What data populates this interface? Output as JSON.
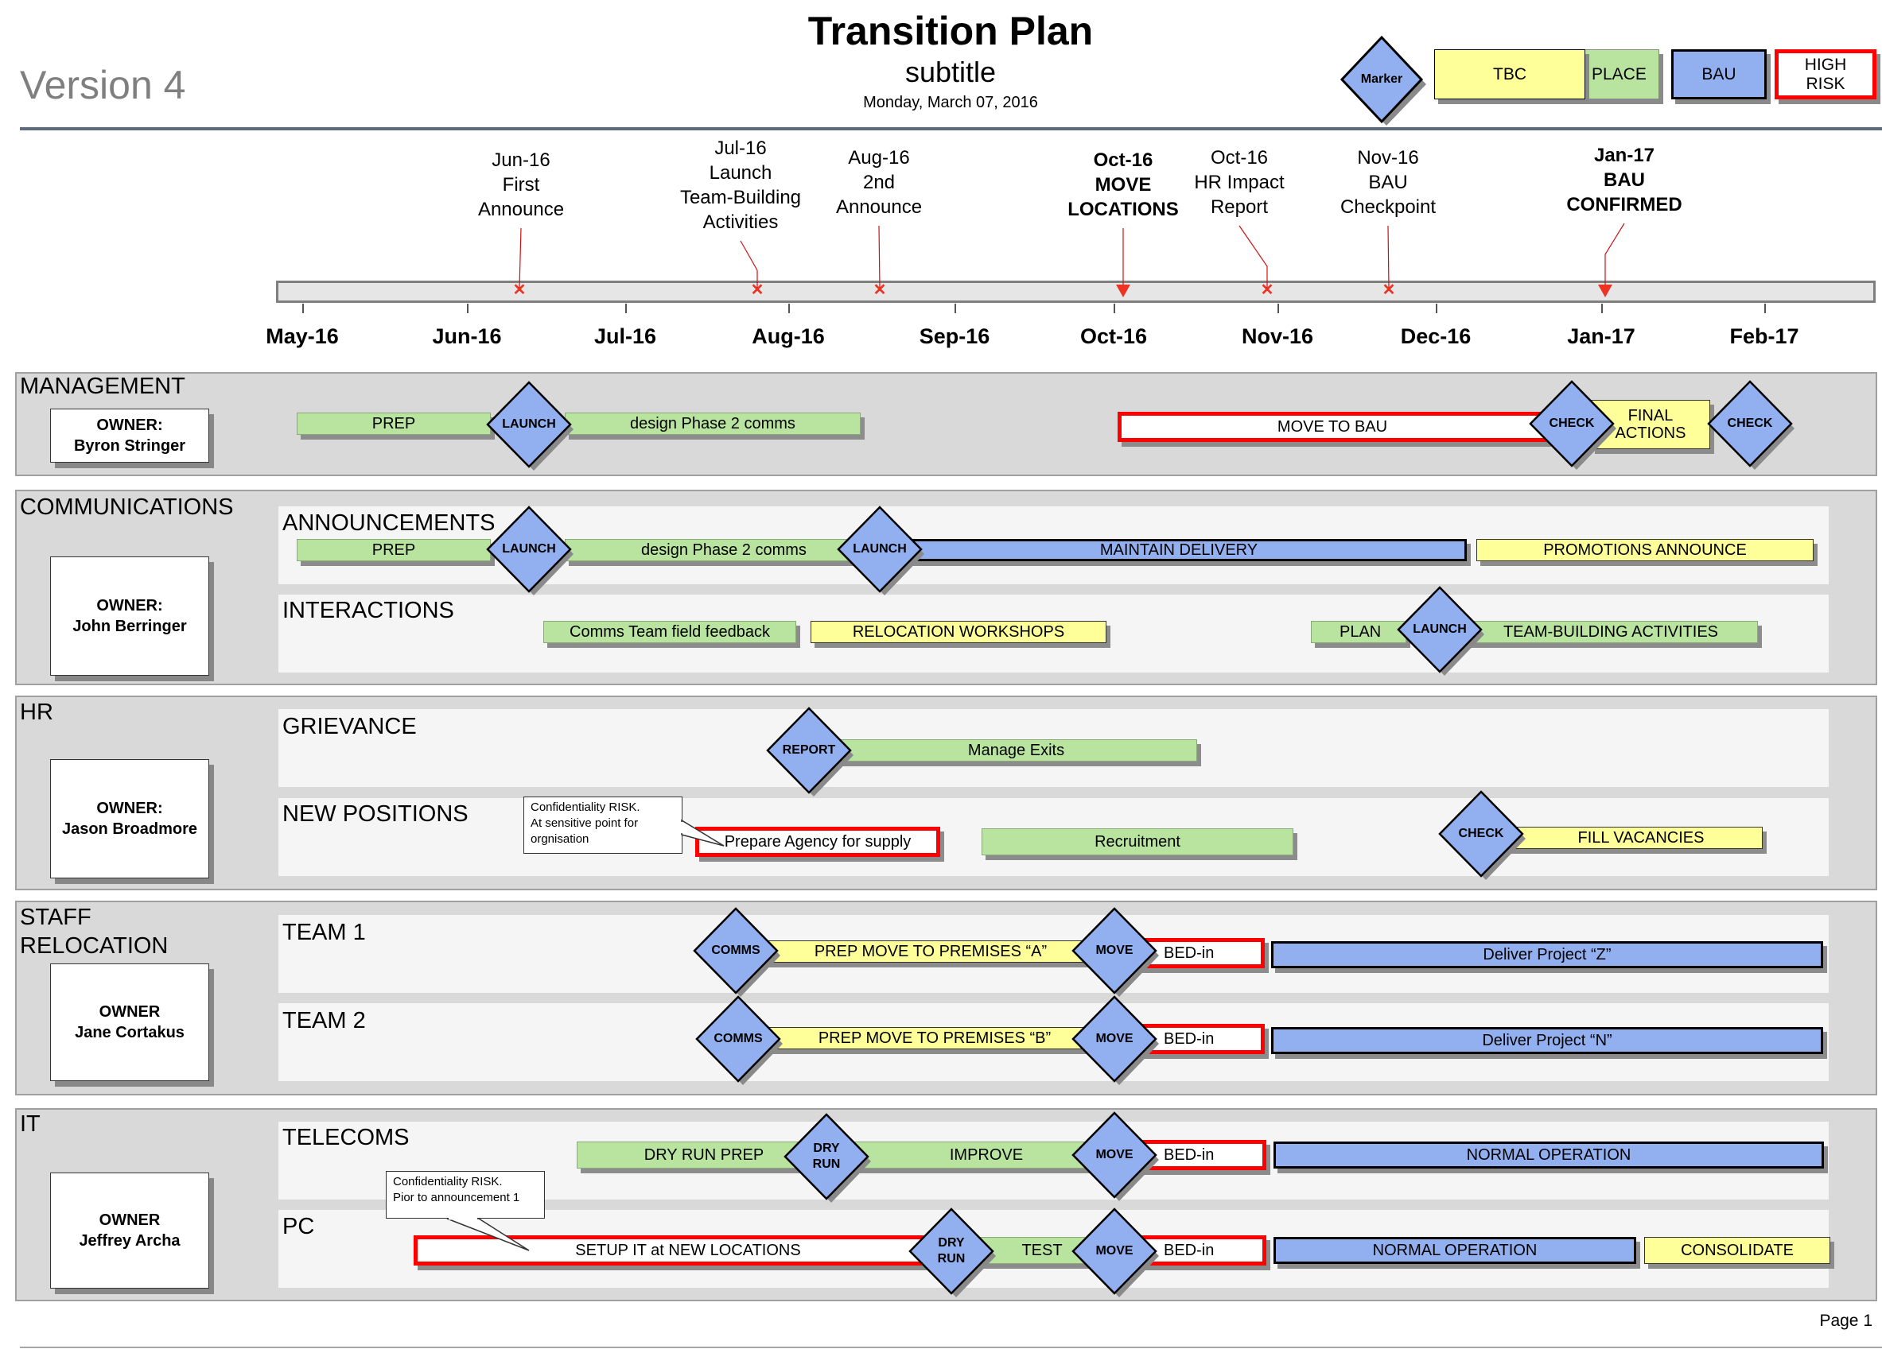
{
  "header": {
    "version": "Version 4",
    "title": "Transition Plan",
    "subtitle": "subtitle",
    "date": "Monday, March 07, 2016",
    "page": "Page 1"
  },
  "legend": {
    "marker": "Marker",
    "tbc": "TBC",
    "in_place": "IN PLACE",
    "bau": "BAU",
    "high_risk_line1": "HIGH",
    "high_risk_line2": "RISK",
    "colors": {
      "tbc": "#ffff99",
      "in_place": "#b8e4a0",
      "bau": "#92afef",
      "high_risk": "#ff0000",
      "marker": "#92afef"
    }
  },
  "timeline": {
    "months": [
      "May-16",
      "Jun-16",
      "Jul-16",
      "Aug-16",
      "Sep-16",
      "Oct-16",
      "Nov-16",
      "Dec-16",
      "Jan-17",
      "Feb-17"
    ],
    "milestones": [
      {
        "lines": [
          "Jun-16",
          "First",
          "Announce"
        ],
        "marker": "x-icon",
        "bold": false
      },
      {
        "lines": [
          "Jul-16",
          "Launch",
          "Team-Building",
          "Activities"
        ],
        "marker": "x-icon",
        "bold": false
      },
      {
        "lines": [
          "Aug-16",
          "2nd",
          "Announce"
        ],
        "marker": "x-icon",
        "bold": false
      },
      {
        "lines": [
          "Oct-16",
          "MOVE",
          "LOCATIONS"
        ],
        "marker": "triangle-down-icon",
        "bold": true
      },
      {
        "lines": [
          "Oct-16",
          "HR Impact",
          "Report"
        ],
        "marker": "x-icon",
        "bold": false
      },
      {
        "lines": [
          "Nov-16",
          "BAU",
          "Checkpoint"
        ],
        "marker": "x-icon",
        "bold": false
      },
      {
        "lines": [
          "Jan-17",
          "BAU",
          "CONFIRMED"
        ],
        "marker": "triangle-down-icon",
        "bold": true
      }
    ]
  },
  "sections": {
    "management": {
      "title": "MANAGEMENT",
      "owner_label": "OWNER:",
      "owner_name": "Byron Stringer",
      "items": {
        "prep": "PREP",
        "launch": "LAUNCH",
        "design": "design Phase 2 comms",
        "move_bau": "MOVE TO BAU",
        "check1": "CHECK",
        "final1": "FINAL",
        "final2": "ACTIONS",
        "check2": "CHECK"
      }
    },
    "communications": {
      "title": "COMMUNICATIONS",
      "owner_label": "OWNER:",
      "owner_name": "John Berringer",
      "lanes": {
        "announcements": {
          "title": "ANNOUNCEMENTS",
          "prep": "PREP",
          "launch1": "LAUNCH",
          "design": "design Phase 2 comms",
          "launch2": "LAUNCH",
          "maintain": "MAINTAIN DELIVERY",
          "promotions": "PROMOTIONS ANNOUNCE"
        },
        "interactions": {
          "title": "INTERACTIONS",
          "feedback": "Comms Team field feedback",
          "workshops": "RELOCATION WORKSHOPS",
          "plan": "PLAN",
          "launch": "LAUNCH",
          "teambuilding": "TEAM-BUILDING ACTIVITIES"
        }
      }
    },
    "hr": {
      "title": "HR",
      "owner_label": "OWNER:",
      "owner_name": "Jason Broadmore",
      "lanes": {
        "grievance": {
          "title": "GRIEVANCE",
          "report": "REPORT",
          "manage": "Manage Exits"
        },
        "new_positions": {
          "title": "NEW POSITIONS",
          "callout": [
            "Confidentiality RISK.",
            "At sensitive point for",
            "orgnisation"
          ],
          "prepare": "Prepare Agency for supply",
          "recruitment": "Recruitment",
          "check": "CHECK",
          "fill": "FILL VACANCIES"
        }
      }
    },
    "staff": {
      "title_line1": "STAFF",
      "title_line2": "RELOCATION",
      "owner_label": "OWNER",
      "owner_name": "Jane Cortakus",
      "lanes": {
        "team1": {
          "title": "TEAM 1",
          "comms": "COMMS",
          "prep": "PREP MOVE TO PREMISES “A”",
          "move": "MOVE",
          "bed": "BED-in",
          "deliver": "Deliver Project “Z”"
        },
        "team2": {
          "title": "TEAM 2",
          "comms": "COMMS",
          "prep": "PREP MOVE TO PREMISES “B”",
          "move": "MOVE",
          "bed": "BED-in",
          "deliver": "Deliver Project “N”"
        }
      }
    },
    "it": {
      "title": "IT",
      "owner_label": "OWNER",
      "owner_name": "Jeffrey Archa",
      "lanes": {
        "telecoms": {
          "title": "TELECOMS",
          "dryprep": "DRY RUN PREP",
          "dryrun1": "DRY",
          "dryrun2": "RUN",
          "improve": "IMPROVE",
          "move": "MOVE",
          "bed": "BED-in",
          "normal": "NORMAL OPERATION"
        },
        "pc": {
          "title": "PC",
          "callout": [
            "Confidentiality RISK.",
            "Pior to announcement 1"
          ],
          "setup": "SETUP IT at NEW LOCATIONS",
          "dryrun1": "DRY",
          "dryrun2": "RUN",
          "test": "TEST",
          "move": "MOVE",
          "bed": "BED-in",
          "normal": "NORMAL OPERATION",
          "consolidate": "CONSOLIDATE"
        }
      }
    }
  }
}
